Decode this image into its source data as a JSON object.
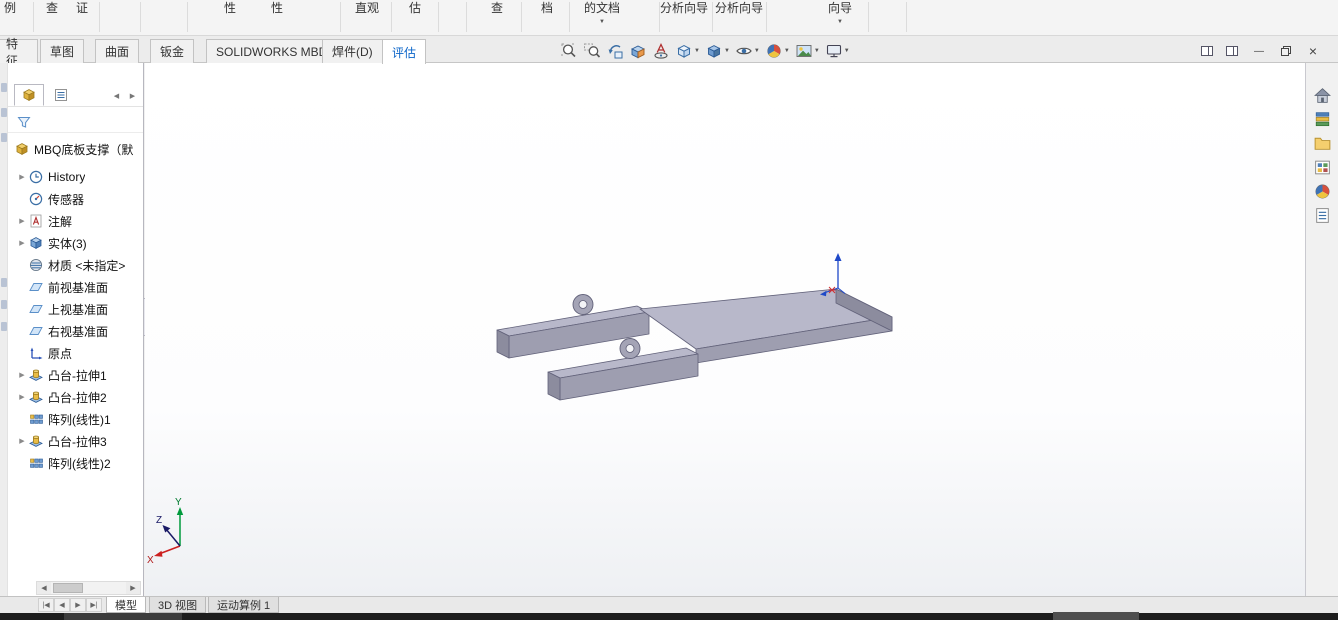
{
  "colors": {
    "accent_blue": "#0a64c8",
    "part_top": "#b8b8ca",
    "part_front": "#9e9eb0",
    "part_side": "#8c8c9e",
    "viewport_bg": "#ffffff",
    "triad_x": "#cc2020",
    "triad_y": "#009a3c",
    "triad_z": "#1a1a66"
  },
  "icons": {
    "caret_down": "▼",
    "expand_right": "▶",
    "scroll_left": "◀",
    "scroll_right": "▶",
    "nav_first": "|◀",
    "nav_prev": "◀",
    "nav_next": "▶",
    "nav_last": "▶|",
    "header_prev": "◀",
    "header_next": "▶",
    "minimize": "—",
    "close": "×"
  },
  "ribbon": {
    "items": [
      {
        "label": "例"
      },
      {
        "label": "查"
      },
      {
        "label": "证"
      },
      {
        "label": "性"
      },
      {
        "label": "性"
      },
      {
        "label": "直观"
      },
      {
        "label": "估"
      },
      {
        "label": "查"
      },
      {
        "label": "档"
      },
      {
        "label": "的文档"
      },
      {
        "label": "分析向导"
      },
      {
        "label": "分析向导"
      },
      {
        "label": "向导"
      }
    ]
  },
  "command_tabs": {
    "active": "评估",
    "tabs": [
      {
        "label": "特征"
      },
      {
        "label": "草图"
      },
      {
        "label": "曲面"
      },
      {
        "label": "钣金"
      },
      {
        "label": "SOLIDWORKS MBD"
      },
      {
        "label": "焊件(D)"
      },
      {
        "label": "评估"
      }
    ]
  },
  "hud": {
    "buttons": [
      "zoom-to-fit",
      "zoom-to-area",
      "previous-view",
      "section-view",
      "dynamic-annotation-views",
      "view-orientation",
      "display-style",
      "hide-show-items",
      "edit-appearance",
      "apply-scene",
      "view-settings"
    ]
  },
  "feature_tree": {
    "root_label": "MBQ底板支撑（默",
    "items": [
      {
        "label": "History",
        "icon": "history"
      },
      {
        "label": "传感器",
        "icon": "sensor"
      },
      {
        "label": "注解",
        "icon": "annotations"
      },
      {
        "label": "实体(3)",
        "icon": "solid-bodies"
      },
      {
        "label": "材质 <未指定>",
        "icon": "material"
      },
      {
        "label": "前视基准面",
        "icon": "plane"
      },
      {
        "label": "上视基准面",
        "icon": "plane"
      },
      {
        "label": "右视基准面",
        "icon": "plane"
      },
      {
        "label": "原点",
        "icon": "origin"
      },
      {
        "label": "凸台-拉伸1",
        "icon": "boss-extrude"
      },
      {
        "label": "凸台-拉伸2",
        "icon": "boss-extrude"
      },
      {
        "label": "阵列(线性)1",
        "icon": "linear-pattern"
      },
      {
        "label": "凸台-拉伸3",
        "icon": "boss-extrude"
      },
      {
        "label": "阵列(线性)2",
        "icon": "linear-pattern"
      }
    ]
  },
  "viewport": {
    "triad": {
      "x": "X",
      "y": "Y",
      "z": "Z"
    }
  },
  "task_pane": {
    "items": [
      "solidworks-resources",
      "design-library",
      "file-explorer",
      "view-palette",
      "appearances-scenes",
      "custom-properties"
    ]
  },
  "bottom_tabs": {
    "active": "模型",
    "tabs": [
      {
        "label": "模型"
      },
      {
        "label": "3D 视图"
      },
      {
        "label": "运动算例 1"
      }
    ]
  }
}
